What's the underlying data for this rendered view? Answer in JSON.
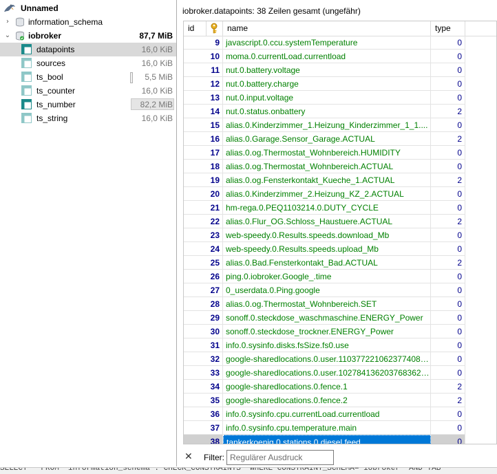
{
  "tree": {
    "connection": "Unnamed",
    "databases": [
      {
        "label": "information_schema",
        "expanded": false
      },
      {
        "label": "iobroker",
        "size": "87,7 MiB",
        "expanded": true,
        "tables": [
          {
            "label": "datapoints",
            "size": "16,0 KiB",
            "selected": true
          },
          {
            "label": "sources",
            "size": "16,0 KiB"
          },
          {
            "label": "ts_bool",
            "size": "5,5 MiB"
          },
          {
            "label": "ts_counter",
            "size": "16,0 KiB"
          },
          {
            "label": "ts_number",
            "size": "82,2 MiB"
          },
          {
            "label": "ts_string",
            "size": "16,0 KiB"
          }
        ]
      }
    ]
  },
  "grid": {
    "summary": "iobroker.datapoints: 38 Zeilen gesamt (ungefähr)",
    "columns": {
      "id": "id",
      "name": "name",
      "type": "type"
    },
    "rows": [
      {
        "id": "9",
        "name": "javascript.0.ccu.systemTemperature",
        "type": "0"
      },
      {
        "id": "10",
        "name": "moma.0.currentLoad.currentload",
        "type": "0"
      },
      {
        "id": "11",
        "name": "nut.0.battery.voltage",
        "type": "0"
      },
      {
        "id": "12",
        "name": "nut.0.battery.charge",
        "type": "0"
      },
      {
        "id": "13",
        "name": "nut.0.input.voltage",
        "type": "0"
      },
      {
        "id": "14",
        "name": "nut.0.status.onbattery",
        "type": "2"
      },
      {
        "id": "15",
        "name": "alias.0.Kinderzimmer_1.Heizung_Kinderzimmer_1_1....",
        "type": "0"
      },
      {
        "id": "16",
        "name": "alias.0.Garage.Sensor_Garage.ACTUAL",
        "type": "2"
      },
      {
        "id": "17",
        "name": "alias.0.og.Thermostat_Wohnbereich.HUMIDITY",
        "type": "0"
      },
      {
        "id": "18",
        "name": "alias.0.og.Thermostat_Wohnbereich.ACTUAL",
        "type": "0"
      },
      {
        "id": "19",
        "name": "alias.0.og.Fensterkontakt_Kueche_1.ACTUAL",
        "type": "2"
      },
      {
        "id": "20",
        "name": "alias.0.Kinderzimmer_2.Heizung_KZ_2.ACTUAL",
        "type": "0"
      },
      {
        "id": "21",
        "name": "hm-rega.0.PEQ1103214.0.DUTY_CYCLE",
        "type": "0"
      },
      {
        "id": "22",
        "name": "alias.0.Flur_OG.Schloss_Haustuere.ACTUAL",
        "type": "2"
      },
      {
        "id": "23",
        "name": "web-speedy.0.Results.speeds.download_Mb",
        "type": "0"
      },
      {
        "id": "24",
        "name": "web-speedy.0.Results.speeds.upload_Mb",
        "type": "0"
      },
      {
        "id": "25",
        "name": "alias.0.Bad.Fensterkontakt_Bad.ACTUAL",
        "type": "2"
      },
      {
        "id": "26",
        "name": "ping.0.iobroker.Google_.time",
        "type": "0"
      },
      {
        "id": "27",
        "name": "0_userdata.0.Ping.google",
        "type": "0"
      },
      {
        "id": "28",
        "name": "alias.0.og.Thermostat_Wohnbereich.SET",
        "type": "0"
      },
      {
        "id": "29",
        "name": "sonoff.0.steckdose_waschmaschine.ENERGY_Power",
        "type": "0"
      },
      {
        "id": "30",
        "name": "sonoff.0.steckdose_trockner.ENERGY_Power",
        "type": "0"
      },
      {
        "id": "31",
        "name": "info.0.sysinfo.disks.fsSize.fs0.use",
        "type": "0"
      },
      {
        "id": "32",
        "name": "google-sharedlocations.0.user.1103772210623774083...",
        "type": "0"
      },
      {
        "id": "33",
        "name": "google-sharedlocations.0.user.1027841362037683620...",
        "type": "0"
      },
      {
        "id": "34",
        "name": "google-sharedlocations.0.fence.1",
        "type": "2"
      },
      {
        "id": "35",
        "name": "google-sharedlocations.0.fence.2",
        "type": "2"
      },
      {
        "id": "36",
        "name": "info.0.sysinfo.cpu.currentLoad.currentload",
        "type": "0"
      },
      {
        "id": "37",
        "name": "info.0.sysinfo.cpu.temperature.main",
        "type": "0"
      },
      {
        "id": "38",
        "name": "tankerkoenig.0.stations.0.diesel.feed",
        "type": "0",
        "selected": true
      }
    ]
  },
  "filter": {
    "label": "Filter:",
    "placeholder": "Regulärer Ausdruck"
  },
  "query_preview": "SELECT * FROM `information_schema`.`CHECK_CONSTRAINTS` WHERE CONSTRAINT_SCHEMA='iobroker' AND TAB",
  "colors": {
    "selection": "#0078d7",
    "id_text": "#00008b",
    "name_text": "#008000"
  }
}
